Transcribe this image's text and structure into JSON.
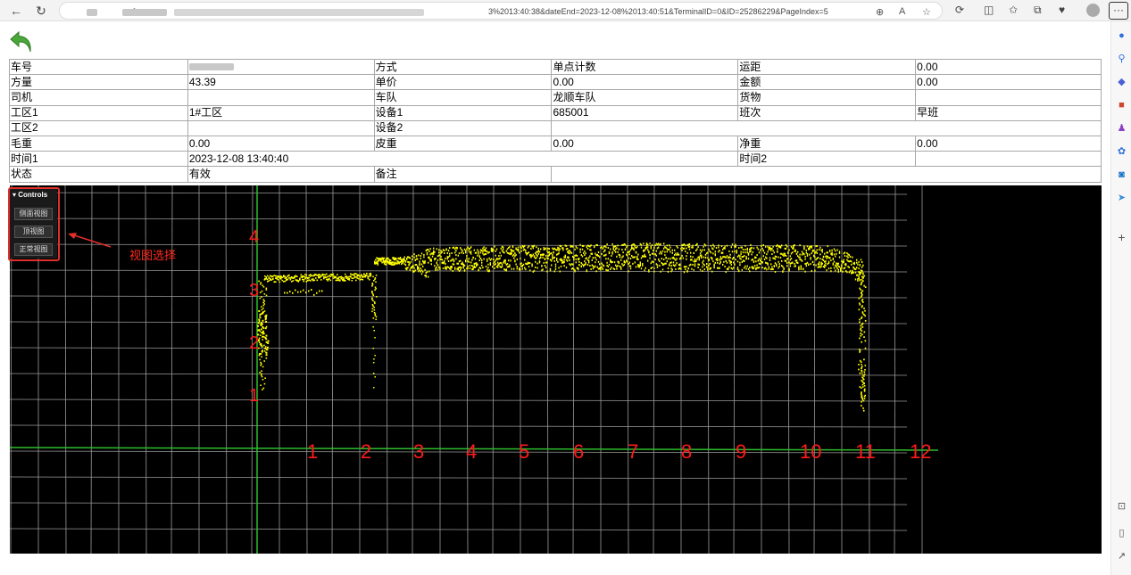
{
  "browser": {
    "url_visible": "3%2013:40:38&dateEnd=2023-12-08%2013:40:51&TerminalID=0&ID=25286229&PageIndex=5",
    "more_label": "···"
  },
  "info": {
    "rows": [
      [
        {
          "label": "车号",
          "value": ""
        },
        {
          "label": "方式",
          "value": "单点计数"
        },
        {
          "label": "运距",
          "value": "0.00"
        }
      ],
      [
        {
          "label": "方量",
          "value": "43.39"
        },
        {
          "label": "单价",
          "value": "0.00"
        },
        {
          "label": "金额",
          "value": "0.00"
        }
      ],
      [
        {
          "label": "司机",
          "value": ""
        },
        {
          "label": "车队",
          "value": "龙顺车队"
        },
        {
          "label": "货物",
          "value": ""
        }
      ],
      [
        {
          "label": "工区1",
          "value": "1#工区"
        },
        {
          "label": "设备1",
          "value": "685001"
        },
        {
          "label": "班次",
          "value": "早班"
        }
      ],
      [
        {
          "label": "工区2",
          "value": ""
        },
        {
          "label": "设备2",
          "value": ""
        }
      ],
      [
        {
          "label": "毛重",
          "value": "0.00"
        },
        {
          "label": "皮重",
          "value": "0.00"
        },
        {
          "label": "净重",
          "value": "0.00"
        }
      ],
      [
        {
          "label": "时间1",
          "value": "2023-12-08 13:40:40"
        },
        {
          "label": "时间2",
          "value": ""
        }
      ],
      [
        {
          "label": "状态",
          "value": "有效"
        },
        {
          "label": "备注",
          "value": ""
        }
      ]
    ]
  },
  "controls": {
    "header": "Controls",
    "buttons": [
      "侧面视图",
      "顶视图",
      "正常视图"
    ]
  },
  "annotation": {
    "text": "视图选择"
  },
  "axes": {
    "x_labels": [
      "1",
      "2",
      "3",
      "4",
      "5",
      "6",
      "7",
      "8",
      "9",
      "10",
      "11",
      "12"
    ],
    "y_labels": [
      "1",
      "2",
      "3",
      "4"
    ]
  },
  "colors": {
    "point_cloud": "#ffff00",
    "axis_labels": "#ff1a1a",
    "grid": "#9a9a9a",
    "axis_line": "#2dbd2d",
    "annotation": "#e0302b"
  }
}
